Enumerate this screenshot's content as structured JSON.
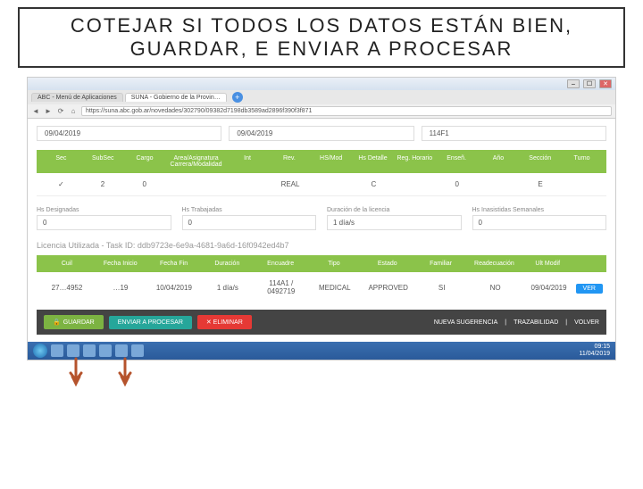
{
  "slide": {
    "title": "COTEJAR SI TODOS LOS DATOS ESTÁN BIEN, GUARDAR, E ENVIAR A PROCESAR"
  },
  "browser": {
    "tabs": [
      {
        "label": "ABC - Menú de Aplicaciones"
      },
      {
        "label": "SUNA - Gobierno de la Provin…"
      }
    ],
    "url": "https://suna.abc.gob.ar/novedades/302790/09382d7198db3589ad2896f390f3f871"
  },
  "topDates": {
    "d1": "09/04/2019",
    "d2": "09/04/2019",
    "d3": "114F1"
  },
  "tableA": {
    "headers": [
      "Sec",
      "SubSec",
      "Cargo",
      "Area/Asignatura Carrera/Modalidad",
      "Int",
      "Rev.",
      "HS/Mod",
      "Hs Detalle",
      "Reg. Horario",
      "Enseñ.",
      "Año",
      "Sección",
      "Turno"
    ],
    "row": [
      "✓",
      "2",
      "0",
      "",
      "",
      "REAL",
      "",
      "C",
      "",
      "0",
      "",
      "E",
      ""
    ]
  },
  "fields": {
    "f1": {
      "label": "Hs Designadas",
      "value": "0"
    },
    "f2": {
      "label": "Hs Trabajadas",
      "value": "0"
    },
    "f3": {
      "label": "Duración de la licencia",
      "value": "1 día/s"
    },
    "f4": {
      "label": "Hs Inasistidas Semanales",
      "value": "0"
    }
  },
  "licencia": "Licencia Utilizada - Task ID: ddb9723e-6e9a-4681-9a6d-16f0942ed4b7",
  "tableB": {
    "headers": [
      "Cuil",
      "Fecha Inicio",
      "Fecha Fin",
      "Duración",
      "Encuadre",
      "Tipo",
      "Estado",
      "Familiar",
      "Readecuación",
      "Ult Modif",
      ""
    ],
    "row": [
      "27…4952",
      "…19",
      "10/04/2019",
      "1 día/s",
      "114A1 / 0492719",
      "MEDICAL",
      "APPROVED",
      "SI",
      "NO",
      "09/04/2019",
      "VER"
    ]
  },
  "actions": {
    "guardar": "GUARDAR",
    "enviar": "ENVIAR A PROCESAR",
    "eliminar": "✕ ELIMINAR",
    "right": [
      "NUEVA SUGERENCIA",
      "TRAZABILIDAD",
      "VOLVER"
    ]
  },
  "clock": {
    "time": "09:15",
    "date": "11/04/2019"
  }
}
